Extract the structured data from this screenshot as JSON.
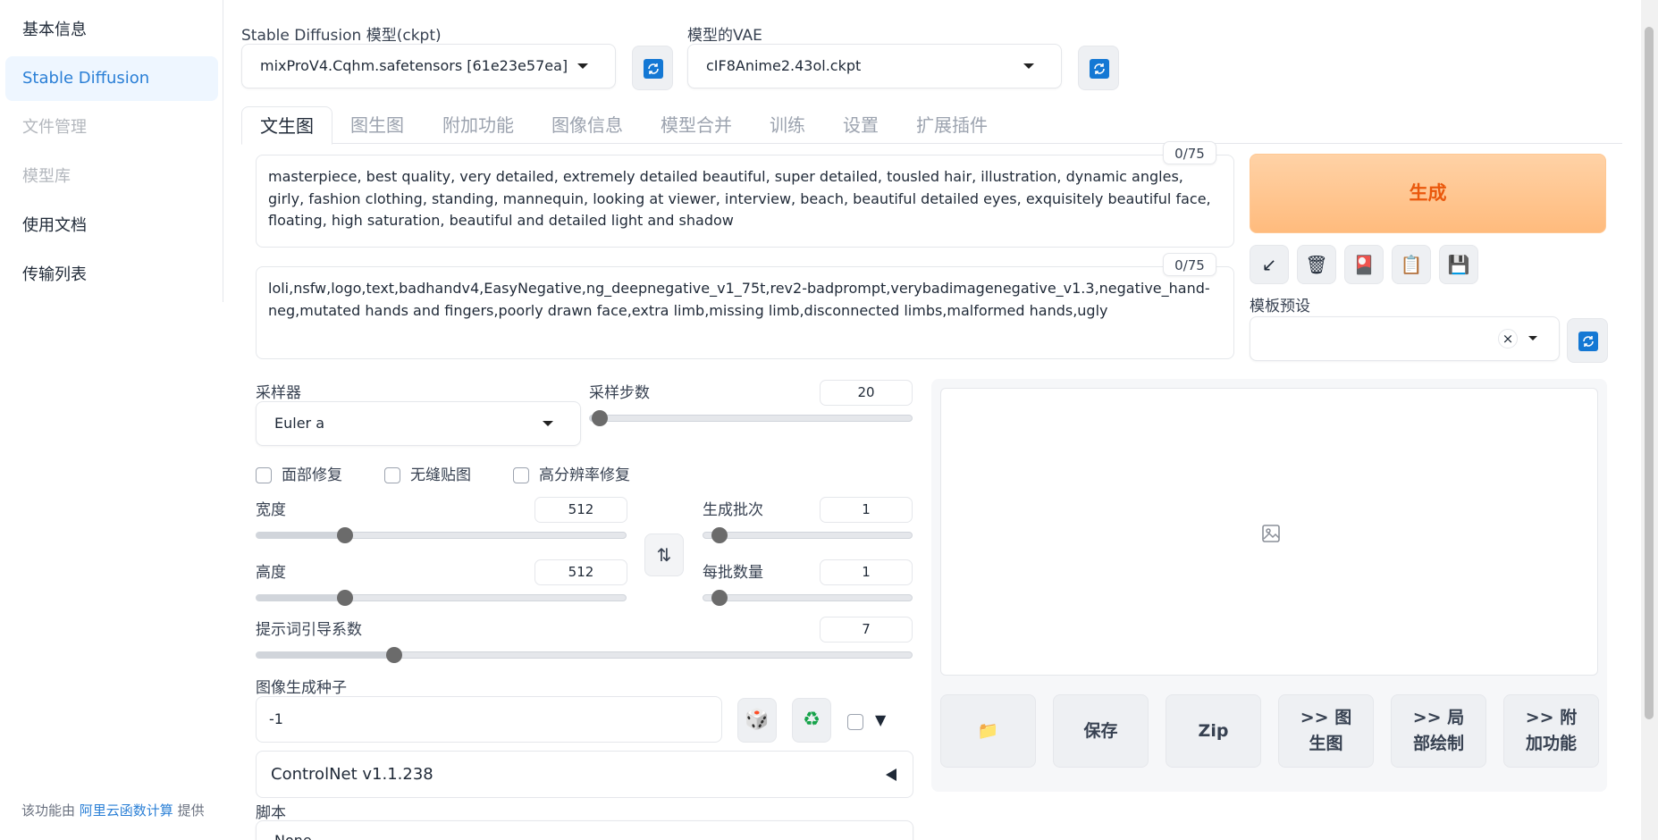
{
  "sidebar": {
    "items": [
      {
        "label": "基本信息",
        "state": "normal"
      },
      {
        "label": "Stable Diffusion",
        "state": "active"
      },
      {
        "label": "文件管理",
        "state": "disabled"
      },
      {
        "label": "模型库",
        "state": "disabled"
      },
      {
        "label": "使用文档",
        "state": "normal"
      },
      {
        "label": "传输列表",
        "state": "normal"
      }
    ],
    "footer": {
      "prefix": "该功能由 ",
      "link": "阿里云函数计算",
      "suffix": " 提供"
    }
  },
  "model": {
    "label": "Stable Diffusion 模型(ckpt)",
    "value": "mixProV4.Cqhm.safetensors [61e23e57ea]"
  },
  "vae": {
    "label": "模型的VAE",
    "value": "cIF8Anime2.43ol.ckpt"
  },
  "tabs": [
    "文生图",
    "图生图",
    "附加功能",
    "图像信息",
    "模型合并",
    "训练",
    "设置",
    "扩展插件"
  ],
  "prompt": {
    "counter": "0/75",
    "text": "masterpiece, best quality, very detailed, extremely detailed beautiful, super detailed, tousled hair, illustration, dynamic angles, girly, fashion clothing, standing, mannequin, looking at viewer, interview, beach, beautiful detailed eyes, exquisitely beautiful face, floating, high saturation, beautiful and detailed light and shadow"
  },
  "negative_prompt": {
    "counter": "0/75",
    "text": "loli,nsfw,logo,text,badhandv4,EasyNegative,ng_deepnegative_v1_75t,rev2-badprompt,verybadimagenegative_v1.3,negative_hand-neg,mutated hands and fingers,poorly drawn face,extra limb,missing limb,disconnected limbs,malformed hands,ugly"
  },
  "generate": {
    "label": "生成"
  },
  "tools": [
    "↙",
    "🗑",
    "🎴",
    "📋",
    "💾"
  ],
  "template": {
    "label": "模板预设",
    "clear": "×"
  },
  "sampler": {
    "label": "采样器",
    "value": "Euler a"
  },
  "steps": {
    "label": "采样步数",
    "value": "20",
    "fraction": 0.03
  },
  "checkboxes": [
    "面部修复",
    "无缝贴图",
    "高分辨率修复"
  ],
  "width": {
    "label": "宽度",
    "value": "512",
    "fraction": 0.24
  },
  "height": {
    "label": "高度",
    "value": "512",
    "fraction": 0.24
  },
  "batch_count": {
    "label": "生成批次",
    "value": "1",
    "fraction": 0.0
  },
  "batch_size": {
    "label": "每批数量",
    "value": "1",
    "fraction": 0.0
  },
  "cfg": {
    "label": "提示词引导系数",
    "value": "7",
    "fraction": 0.21
  },
  "seed": {
    "label": "图像生成种子",
    "value": "-1"
  },
  "swap_icon": "⇅",
  "dice_icon": "🎲",
  "recycle_icon": "♻",
  "extra_arrow": "▼",
  "controlnet": {
    "title": "ControlNet v1.1.238"
  },
  "script": {
    "label": "脚本",
    "value": "None"
  },
  "output_buttons": [
    {
      "label": "📁"
    },
    {
      "label": "保存"
    },
    {
      "label": "Zip"
    },
    {
      "label": ">> 图\n生图"
    },
    {
      "label": ">> 局\n部绘制"
    },
    {
      "label": ">> 附\n加功能"
    }
  ],
  "colors": {
    "accent": "#2a7fd6",
    "generate": "#ffbb7d",
    "generate_text": "#ea580c",
    "refresh": "#1478d4"
  }
}
